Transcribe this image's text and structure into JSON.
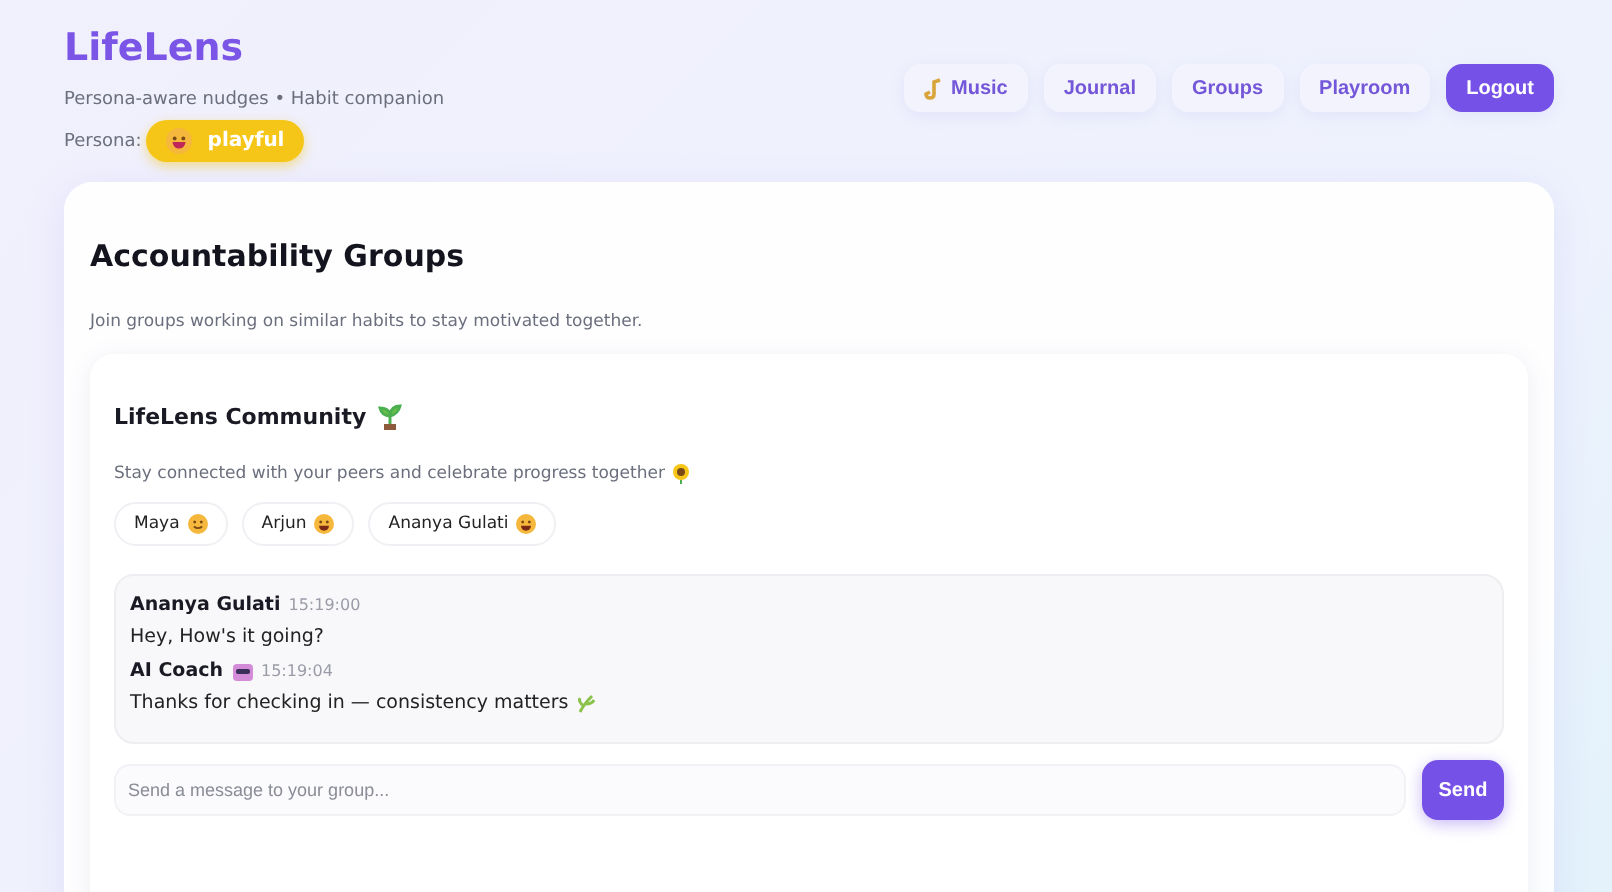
{
  "brand": {
    "title": "LifeLens",
    "tagline": "Persona-aware nudges • Habit companion",
    "persona_label": "Persona:",
    "persona": "playful"
  },
  "nav": [
    {
      "label": "Music",
      "kind": "music"
    },
    {
      "label": "Journal",
      "kind": "plain"
    },
    {
      "label": "Groups",
      "kind": "plain"
    },
    {
      "label": "Playroom",
      "kind": "plain"
    },
    {
      "label": "Logout",
      "kind": "primary"
    }
  ],
  "page": {
    "title": "Accountability Groups",
    "subtitle": "Join groups working on similar habits to stay motivated together."
  },
  "group": {
    "name": "LifeLens Community",
    "description": "Stay connected with your peers and celebrate progress together",
    "members": [
      {
        "name": "Maya",
        "kind": "smile"
      },
      {
        "name": "Arjun",
        "kind": "grin"
      },
      {
        "name": "Ananya Gulati",
        "kind": "grin"
      }
    ],
    "messages": [
      {
        "author": "Ananya Gulati",
        "kind": "user",
        "time": "15:19:00",
        "text": "Hey, How's it going?"
      },
      {
        "author": "AI Coach",
        "kind": "bot",
        "time": "15:19:04",
        "text": "Thanks for checking in — consistency matters"
      }
    ],
    "composer": {
      "placeholder": "Send a message to your group...",
      "button": "Send"
    }
  }
}
